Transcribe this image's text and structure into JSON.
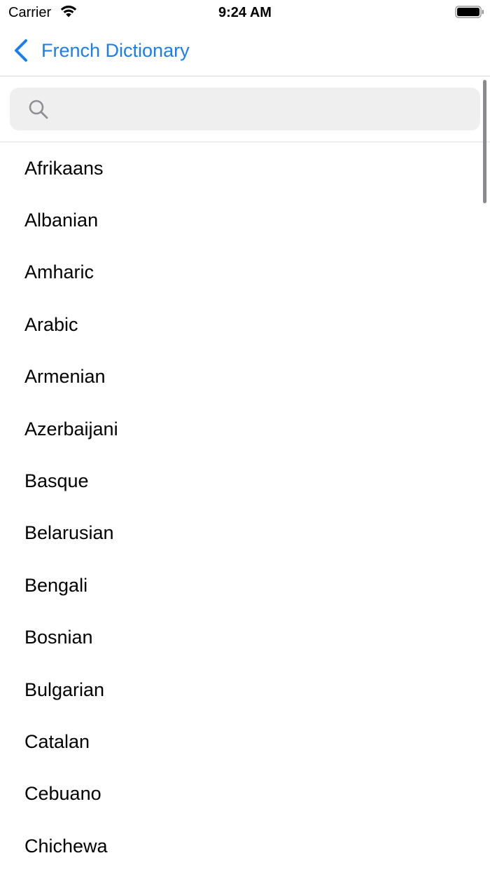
{
  "status_bar": {
    "carrier": "Carrier",
    "time": "9:24 AM",
    "wifi_icon": "wifi-icon",
    "battery_icon": "battery-icon"
  },
  "nav": {
    "back_label": "French Dictionary",
    "back_icon": "chevron-left-icon",
    "accent_color": "#1a7ef2"
  },
  "search": {
    "value": "",
    "placeholder": "",
    "icon": "search-icon"
  },
  "languages": [
    "Afrikaans",
    "Albanian",
    "Amharic",
    "Arabic",
    "Armenian",
    "Azerbaijani",
    "Basque",
    "Belarusian",
    "Bengali",
    "Bosnian",
    "Bulgarian",
    "Catalan",
    "Cebuano",
    "Chichewa"
  ]
}
